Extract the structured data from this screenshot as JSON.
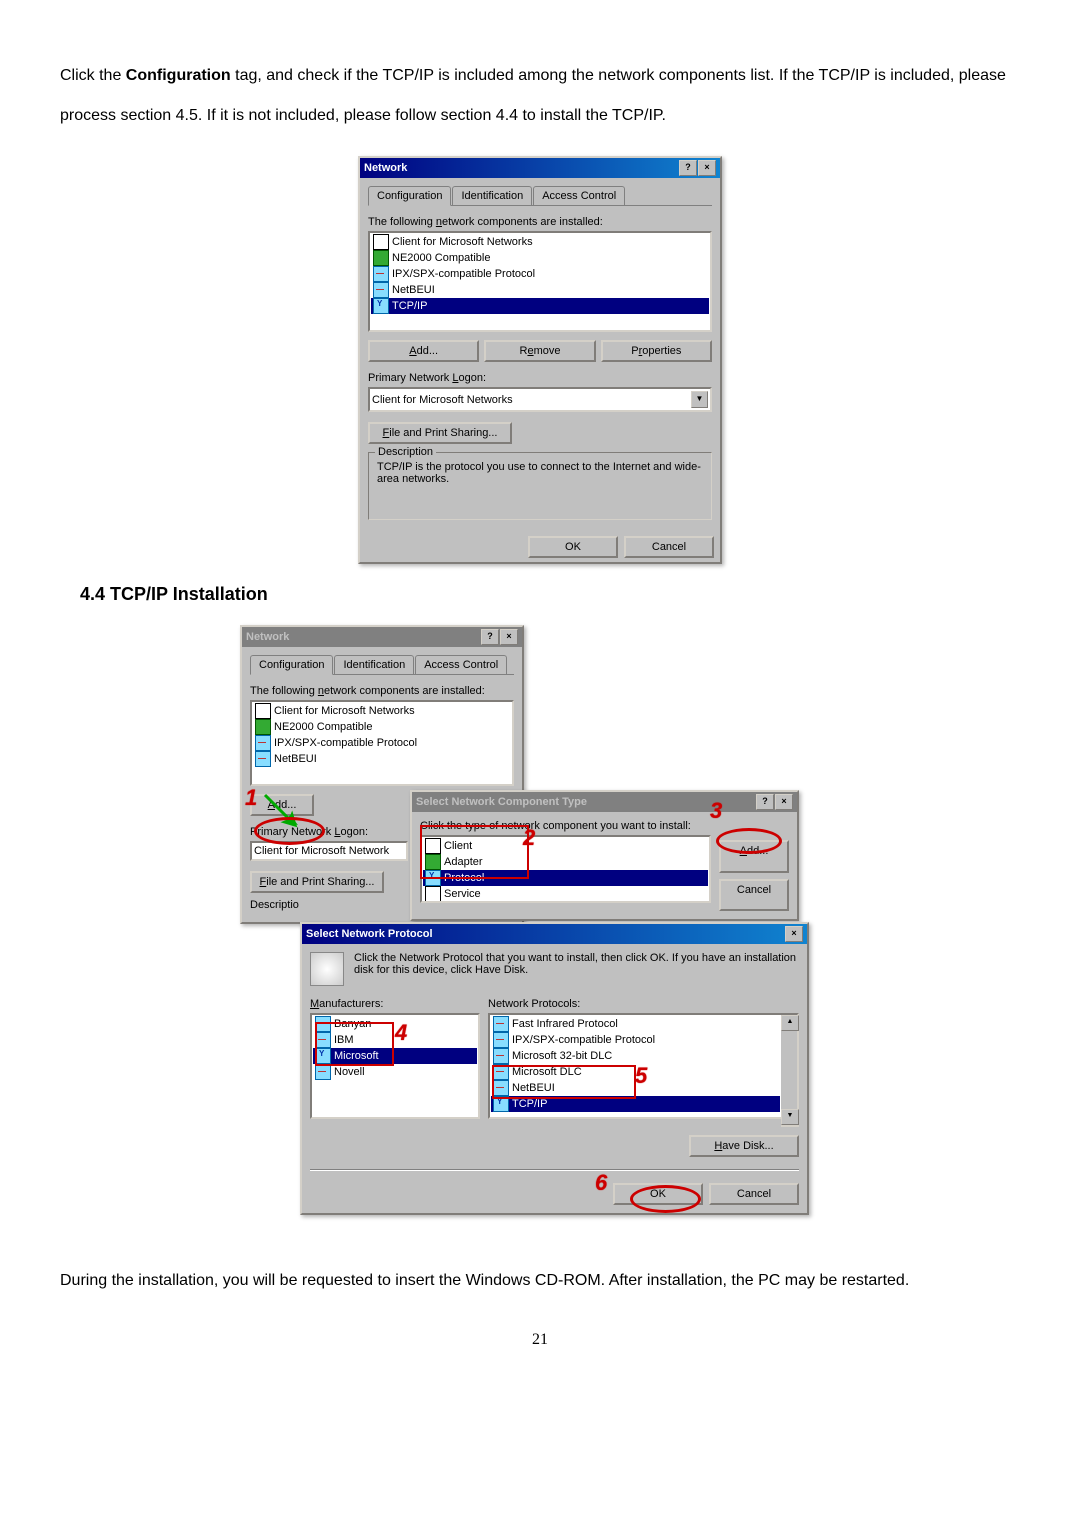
{
  "para1_pre": "Click the ",
  "para1_bold": "Configuration",
  "para1_post": " tag, and check if the TCP/IP is included among the network components list. If the TCP/IP is included, please process section 4.5. If it is not included, please follow section 4.4 to install the TCP/IP.",
  "dialog1": {
    "title": "Network",
    "help_btn": "?",
    "close_btn": "×",
    "tabs": [
      "Configuration",
      "Identification",
      "Access Control"
    ],
    "list_label": "The following network components are installed:",
    "items": [
      "Client for Microsoft Networks",
      "NE2000 Compatible",
      "IPX/SPX-compatible Protocol",
      "NetBEUI",
      "TCP/IP"
    ],
    "add_btn": "Add...",
    "remove_btn": "Remove",
    "properties_btn": "Properties",
    "primary_label": "Primary Network Logon:",
    "primary_value": "Client for Microsoft Networks",
    "fps_btn": "File and Print Sharing...",
    "desc_legend": "Description",
    "desc_text": "TCP/IP is the protocol you use to connect to the Internet and wide-area networks.",
    "ok": "OK",
    "cancel": "Cancel"
  },
  "section_heading": "4.4 TCP/IP Installation",
  "dialog2": {
    "title": "Network",
    "tabs": [
      "Configuration",
      "Identification",
      "Access Control"
    ],
    "list_label": "The following network components are installed:",
    "items": [
      "Client for Microsoft Networks",
      "NE2000 Compatible",
      "IPX/SPX-compatible Protocol",
      "NetBEUI"
    ],
    "add_btn": "Add...",
    "primary_label": "Primary Network Logon:",
    "primary_value": "Client for Microsoft Network",
    "fps_btn": "File and Print Sharing...",
    "desc_legend": "Descriptio"
  },
  "dialog3": {
    "title": "Select Network Component Type",
    "instruct": "Click the type of network component you want to install:",
    "items": [
      "Client",
      "Adapter",
      "Protocol",
      "Service"
    ],
    "add_btn": "Add...",
    "cancel": "Cancel"
  },
  "dialog4": {
    "title": "Select Network Protocol",
    "instruct": "Click the Network Protocol that you want to install, then click OK. If you have an installation disk for this device, click Have Disk.",
    "manuf_label": "Manufacturers:",
    "proto_label": "Network Protocols:",
    "manufs": [
      "Banyan",
      "IBM",
      "Microsoft",
      "Novell"
    ],
    "protos": [
      "Fast Infrared Protocol",
      "IPX/SPX-compatible Protocol",
      "Microsoft 32-bit DLC",
      "Microsoft DLC",
      "NetBEUI",
      "TCP/IP"
    ],
    "have_disk": "Have Disk...",
    "ok": "OK",
    "cancel": "Cancel"
  },
  "numbers": [
    "1",
    "2",
    "3",
    "4",
    "5",
    "6"
  ],
  "para2": "During the installation, you will be requested to insert the Windows CD-ROM. After installation, the PC may be restarted.",
  "page_num": "21"
}
